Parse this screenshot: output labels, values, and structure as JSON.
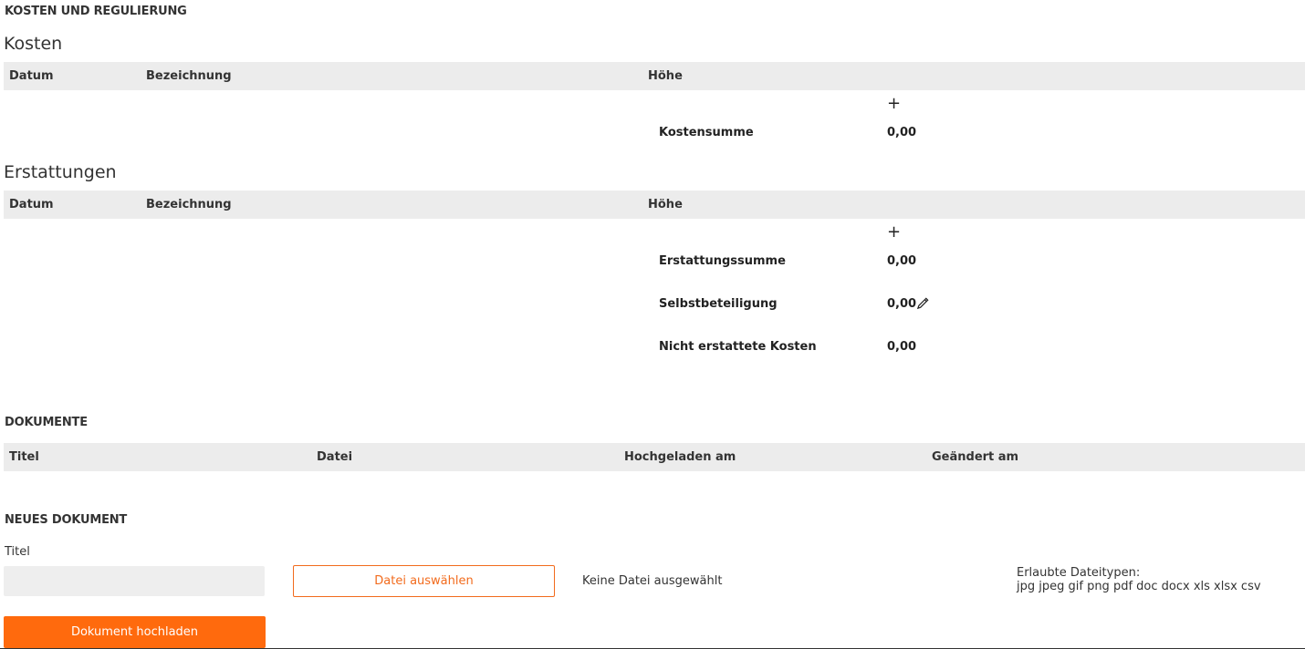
{
  "header": {
    "title": "KOSTEN UND REGULIERUNG"
  },
  "kosten": {
    "title": "Kosten",
    "columns": [
      "Datum",
      "Bezeichnung",
      "Höhe"
    ],
    "add_symbol": "+",
    "sum_label": "Kostensumme",
    "sum_value": "0,00"
  },
  "erstattungen": {
    "title": "Erstattungen",
    "columns": [
      "Datum",
      "Bezeichnung",
      "Höhe"
    ],
    "add_symbol": "+",
    "sum_label": "Erstattungssumme",
    "sum_value": "0,00",
    "selbst_label": "Selbstbeteiligung",
    "selbst_value": "0,00",
    "nicht_label": "Nicht erstattete Kosten",
    "nicht_value": "0,00",
    "edit_icon": "pencil-icon"
  },
  "dokumente": {
    "title": "DOKUMENTE",
    "columns": [
      "Titel",
      "Datei",
      "Hochgeladen am",
      "Geändert am"
    ]
  },
  "neues_dokument": {
    "title": "NEUES DOKUMENT",
    "titel_label": "Titel",
    "titel_value": "",
    "file_button": "Datei auswählen",
    "file_status": "Keine Datei ausgewählt",
    "allowed_label": "Erlaubte Dateitypen:",
    "allowed_types": "jpg jpeg gif png pdf doc docx xls xlsx csv",
    "upload_button": "Dokument hochladen"
  },
  "colors": {
    "accent": "#ff6a0d",
    "header_bg": "#ececec"
  }
}
